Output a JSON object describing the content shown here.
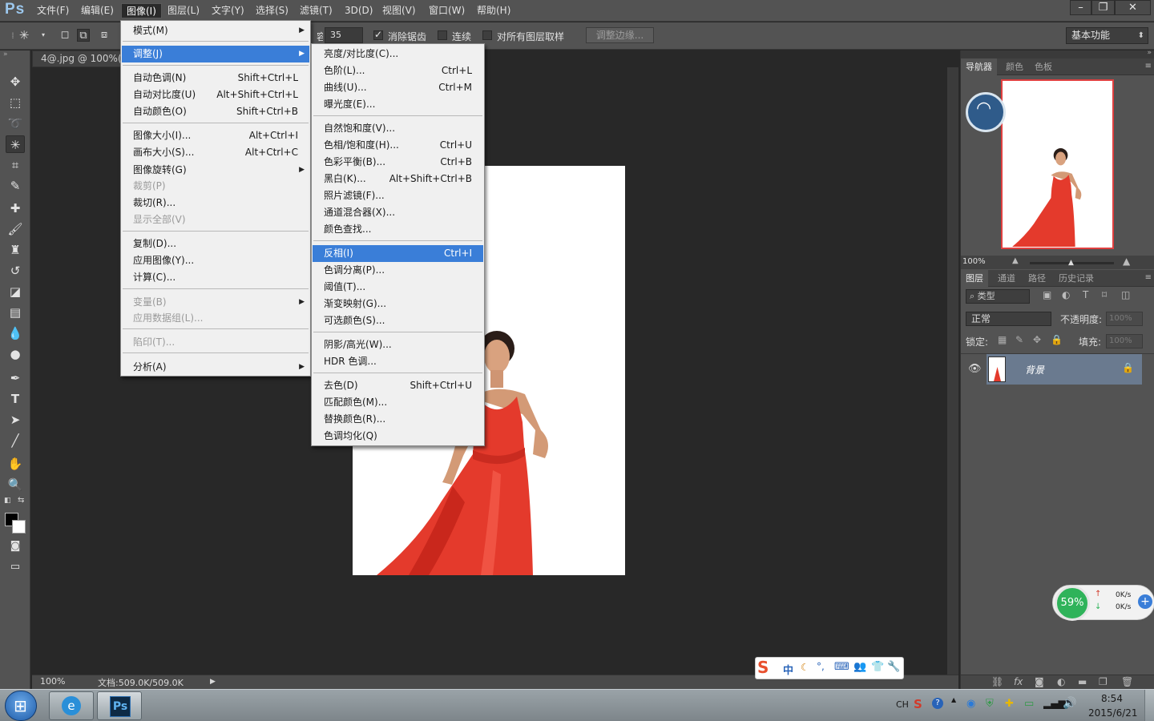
{
  "app": {
    "logo": "Ps",
    "menu": [
      "文件(F)",
      "编辑(E)",
      "图像(I)",
      "图层(L)",
      "文字(Y)",
      "选择(S)",
      "滤镜(T)",
      "3D(D)",
      "视图(V)",
      "窗口(W)",
      "帮助(H)"
    ],
    "active_menu": "图像(I)"
  },
  "options_bar": {
    "tolerance_label": "容差:",
    "tolerance_value": "35",
    "antialias_label": "消除锯齿",
    "contiguous_label": "连续",
    "sample_all_label": "对所有图层取样",
    "refine_edge_label": "调整边缘...",
    "workspace_value": "基本功能"
  },
  "document": {
    "tab_title": "4@.jpg @ 100%(RGB/8)",
    "zoom": "100%",
    "doc_size": "文档:509.0K/509.0K"
  },
  "image_menu": [
    {
      "label": "模式(M)",
      "shortcut": "",
      "submenu": true,
      "disabled": false
    },
    {
      "label": "调整(J)",
      "shortcut": "",
      "submenu": true,
      "disabled": false,
      "highlighted": true
    },
    {
      "label": "自动色调(N)",
      "shortcut": "Shift+Ctrl+L",
      "disabled": false
    },
    {
      "label": "自动对比度(U)",
      "shortcut": "Alt+Shift+Ctrl+L",
      "disabled": false
    },
    {
      "label": "自动颜色(O)",
      "shortcut": "Shift+Ctrl+B",
      "disabled": false
    },
    {
      "label": "图像大小(I)...",
      "shortcut": "Alt+Ctrl+I",
      "disabled": false
    },
    {
      "label": "画布大小(S)...",
      "shortcut": "Alt+Ctrl+C",
      "disabled": false
    },
    {
      "label": "图像旋转(G)",
      "shortcut": "",
      "submenu": true,
      "disabled": false
    },
    {
      "label": "裁剪(P)",
      "shortcut": "",
      "disabled": true
    },
    {
      "label": "裁切(R)...",
      "shortcut": "",
      "disabled": false
    },
    {
      "label": "显示全部(V)",
      "shortcut": "",
      "disabled": true
    },
    {
      "label": "复制(D)...",
      "shortcut": "",
      "disabled": false
    },
    {
      "label": "应用图像(Y)...",
      "shortcut": "",
      "disabled": false
    },
    {
      "label": "计算(C)...",
      "shortcut": "",
      "disabled": false
    },
    {
      "label": "变量(B)",
      "shortcut": "",
      "submenu": true,
      "disabled": true
    },
    {
      "label": "应用数据组(L)...",
      "shortcut": "",
      "disabled": true
    },
    {
      "label": "陷印(T)...",
      "shortcut": "",
      "disabled": true
    },
    {
      "label": "分析(A)",
      "shortcut": "",
      "submenu": true,
      "disabled": false
    }
  ],
  "adjust_menu": [
    {
      "label": "亮度/对比度(C)...",
      "shortcut": ""
    },
    {
      "label": "色阶(L)...",
      "shortcut": "Ctrl+L"
    },
    {
      "label": "曲线(U)...",
      "shortcut": "Ctrl+M"
    },
    {
      "label": "曝光度(E)...",
      "shortcut": ""
    },
    {
      "label": "自然饱和度(V)...",
      "shortcut": ""
    },
    {
      "label": "色相/饱和度(H)...",
      "shortcut": "Ctrl+U"
    },
    {
      "label": "色彩平衡(B)...",
      "shortcut": "Ctrl+B"
    },
    {
      "label": "黑白(K)...",
      "shortcut": "Alt+Shift+Ctrl+B"
    },
    {
      "label": "照片滤镜(F)...",
      "shortcut": ""
    },
    {
      "label": "通道混合器(X)...",
      "shortcut": ""
    },
    {
      "label": "颜色查找...",
      "shortcut": ""
    },
    {
      "label": "反相(I)",
      "shortcut": "Ctrl+I",
      "highlighted": true
    },
    {
      "label": "色调分离(P)...",
      "shortcut": ""
    },
    {
      "label": "阈值(T)...",
      "shortcut": ""
    },
    {
      "label": "渐变映射(G)...",
      "shortcut": ""
    },
    {
      "label": "可选颜色(S)...",
      "shortcut": ""
    },
    {
      "label": "阴影/高光(W)...",
      "shortcut": ""
    },
    {
      "label": "HDR 色调...",
      "shortcut": ""
    },
    {
      "label": "去色(D)",
      "shortcut": "Shift+Ctrl+U"
    },
    {
      "label": "匹配颜色(M)...",
      "shortcut": ""
    },
    {
      "label": "替换颜色(R)...",
      "shortcut": ""
    },
    {
      "label": "色调均化(Q)",
      "shortcut": ""
    }
  ],
  "navigator": {
    "tabs": [
      "导航器",
      "颜色",
      "色板"
    ],
    "zoom": "100%"
  },
  "layers": {
    "tabs": [
      "图层",
      "通道",
      "路径",
      "历史记录"
    ],
    "filter_label": "类型",
    "blend_mode": "正常",
    "opacity_label": "不透明度:",
    "opacity_value": "100%",
    "lock_label": "锁定:",
    "fill_label": "填充:",
    "fill_value": "100%",
    "layer_name": "背景"
  },
  "net_widget": {
    "percent": "59%",
    "up": "0K/s",
    "down": "0K/s"
  },
  "ime": {
    "mode": "中"
  },
  "taskbar": {
    "lang": "CH",
    "time": "8:54",
    "date": "2015/6/21"
  },
  "colors": {
    "accent_highlight": "#3a7ed8",
    "dress_red": "#e43a2c",
    "nav_frame": "#e04040"
  }
}
